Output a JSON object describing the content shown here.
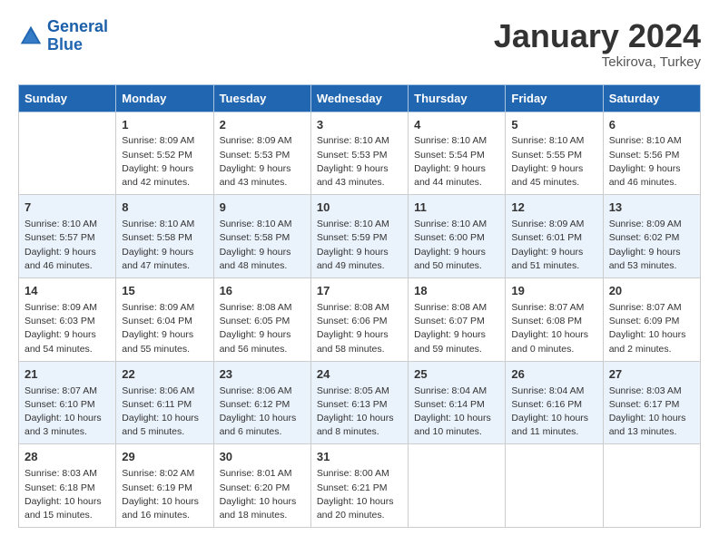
{
  "header": {
    "logo_line1": "General",
    "logo_line2": "Blue",
    "month": "January 2024",
    "location": "Tekirova, Turkey"
  },
  "days_of_week": [
    "Sunday",
    "Monday",
    "Tuesday",
    "Wednesday",
    "Thursday",
    "Friday",
    "Saturday"
  ],
  "weeks": [
    [
      {
        "day": "",
        "info": ""
      },
      {
        "day": "1",
        "info": "Sunrise: 8:09 AM\nSunset: 5:52 PM\nDaylight: 9 hours\nand 42 minutes."
      },
      {
        "day": "2",
        "info": "Sunrise: 8:09 AM\nSunset: 5:53 PM\nDaylight: 9 hours\nand 43 minutes."
      },
      {
        "day": "3",
        "info": "Sunrise: 8:10 AM\nSunset: 5:53 PM\nDaylight: 9 hours\nand 43 minutes."
      },
      {
        "day": "4",
        "info": "Sunrise: 8:10 AM\nSunset: 5:54 PM\nDaylight: 9 hours\nand 44 minutes."
      },
      {
        "day": "5",
        "info": "Sunrise: 8:10 AM\nSunset: 5:55 PM\nDaylight: 9 hours\nand 45 minutes."
      },
      {
        "day": "6",
        "info": "Sunrise: 8:10 AM\nSunset: 5:56 PM\nDaylight: 9 hours\nand 46 minutes."
      }
    ],
    [
      {
        "day": "7",
        "info": "Sunrise: 8:10 AM\nSunset: 5:57 PM\nDaylight: 9 hours\nand 46 minutes."
      },
      {
        "day": "8",
        "info": "Sunrise: 8:10 AM\nSunset: 5:58 PM\nDaylight: 9 hours\nand 47 minutes."
      },
      {
        "day": "9",
        "info": "Sunrise: 8:10 AM\nSunset: 5:58 PM\nDaylight: 9 hours\nand 48 minutes."
      },
      {
        "day": "10",
        "info": "Sunrise: 8:10 AM\nSunset: 5:59 PM\nDaylight: 9 hours\nand 49 minutes."
      },
      {
        "day": "11",
        "info": "Sunrise: 8:10 AM\nSunset: 6:00 PM\nDaylight: 9 hours\nand 50 minutes."
      },
      {
        "day": "12",
        "info": "Sunrise: 8:09 AM\nSunset: 6:01 PM\nDaylight: 9 hours\nand 51 minutes."
      },
      {
        "day": "13",
        "info": "Sunrise: 8:09 AM\nSunset: 6:02 PM\nDaylight: 9 hours\nand 53 minutes."
      }
    ],
    [
      {
        "day": "14",
        "info": "Sunrise: 8:09 AM\nSunset: 6:03 PM\nDaylight: 9 hours\nand 54 minutes."
      },
      {
        "day": "15",
        "info": "Sunrise: 8:09 AM\nSunset: 6:04 PM\nDaylight: 9 hours\nand 55 minutes."
      },
      {
        "day": "16",
        "info": "Sunrise: 8:08 AM\nSunset: 6:05 PM\nDaylight: 9 hours\nand 56 minutes."
      },
      {
        "day": "17",
        "info": "Sunrise: 8:08 AM\nSunset: 6:06 PM\nDaylight: 9 hours\nand 58 minutes."
      },
      {
        "day": "18",
        "info": "Sunrise: 8:08 AM\nSunset: 6:07 PM\nDaylight: 9 hours\nand 59 minutes."
      },
      {
        "day": "19",
        "info": "Sunrise: 8:07 AM\nSunset: 6:08 PM\nDaylight: 10 hours\nand 0 minutes."
      },
      {
        "day": "20",
        "info": "Sunrise: 8:07 AM\nSunset: 6:09 PM\nDaylight: 10 hours\nand 2 minutes."
      }
    ],
    [
      {
        "day": "21",
        "info": "Sunrise: 8:07 AM\nSunset: 6:10 PM\nDaylight: 10 hours\nand 3 minutes."
      },
      {
        "day": "22",
        "info": "Sunrise: 8:06 AM\nSunset: 6:11 PM\nDaylight: 10 hours\nand 5 minutes."
      },
      {
        "day": "23",
        "info": "Sunrise: 8:06 AM\nSunset: 6:12 PM\nDaylight: 10 hours\nand 6 minutes."
      },
      {
        "day": "24",
        "info": "Sunrise: 8:05 AM\nSunset: 6:13 PM\nDaylight: 10 hours\nand 8 minutes."
      },
      {
        "day": "25",
        "info": "Sunrise: 8:04 AM\nSunset: 6:14 PM\nDaylight: 10 hours\nand 10 minutes."
      },
      {
        "day": "26",
        "info": "Sunrise: 8:04 AM\nSunset: 6:16 PM\nDaylight: 10 hours\nand 11 minutes."
      },
      {
        "day": "27",
        "info": "Sunrise: 8:03 AM\nSunset: 6:17 PM\nDaylight: 10 hours\nand 13 minutes."
      }
    ],
    [
      {
        "day": "28",
        "info": "Sunrise: 8:03 AM\nSunset: 6:18 PM\nDaylight: 10 hours\nand 15 minutes."
      },
      {
        "day": "29",
        "info": "Sunrise: 8:02 AM\nSunset: 6:19 PM\nDaylight: 10 hours\nand 16 minutes."
      },
      {
        "day": "30",
        "info": "Sunrise: 8:01 AM\nSunset: 6:20 PM\nDaylight: 10 hours\nand 18 minutes."
      },
      {
        "day": "31",
        "info": "Sunrise: 8:00 AM\nSunset: 6:21 PM\nDaylight: 10 hours\nand 20 minutes."
      },
      {
        "day": "",
        "info": ""
      },
      {
        "day": "",
        "info": ""
      },
      {
        "day": "",
        "info": ""
      }
    ]
  ]
}
